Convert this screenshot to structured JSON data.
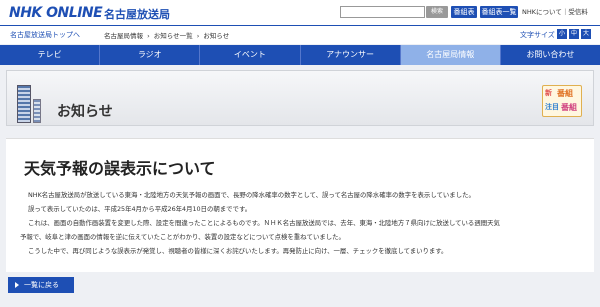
{
  "header": {
    "logo": "NHK ONLINE",
    "station": "名古屋放送局",
    "search_button": "検索",
    "schedule_button": "番組表",
    "regional_schedule_button": "番組表一覧",
    "about_link": "NHKについて｜受信料"
  },
  "subheader": {
    "top_link": "名古屋放送局トップへ",
    "breadcrumbs": [
      "名古屋局情報",
      "›",
      "お知らせ一覧",
      "›",
      "お知らせ"
    ],
    "textsize_label": "文字サイズ",
    "textsize_options": [
      "小",
      "中",
      "大"
    ]
  },
  "nav": {
    "items": [
      "テレビ",
      "ラジオ",
      "イベント",
      "アナウンサー",
      "名古屋局情報",
      "お問い合わせ"
    ],
    "active_index": 4
  },
  "banner": {
    "title": "お知らせ",
    "badge": [
      "新",
      "番組",
      "注目",
      "番組"
    ]
  },
  "article": {
    "title": "天気予報の誤表示について",
    "paragraphs": [
      "NHK名古屋放送局が放送している東海・北陸地方の天気予報の画面で、長野の降水確率の数字として、誤って名古屋の降水確率の数字を表示していました。",
      "誤って表示していたのは、平成25年4月から平成26年4月10日の朝までです。",
      "これは、画面の自動作画装置を変更した際、設定を間違ったことによるものです。ＮＨＫ名古屋放送局では、去年、東海・北陸地方７県向けに放送している週間天気",
      "予報で、岐阜と津の画面の情報を逆に伝えていたことがわかり、装置の設定などについて点検を重ねていました。",
      "こうした中で、再び同じような誤表示が発覚し、視聴者の皆様に深くお詫びいたします。再発防止に向け、一層、チェックを徹底してまいります。"
    ]
  },
  "footer": {
    "back_button": "一覧に戻る"
  }
}
